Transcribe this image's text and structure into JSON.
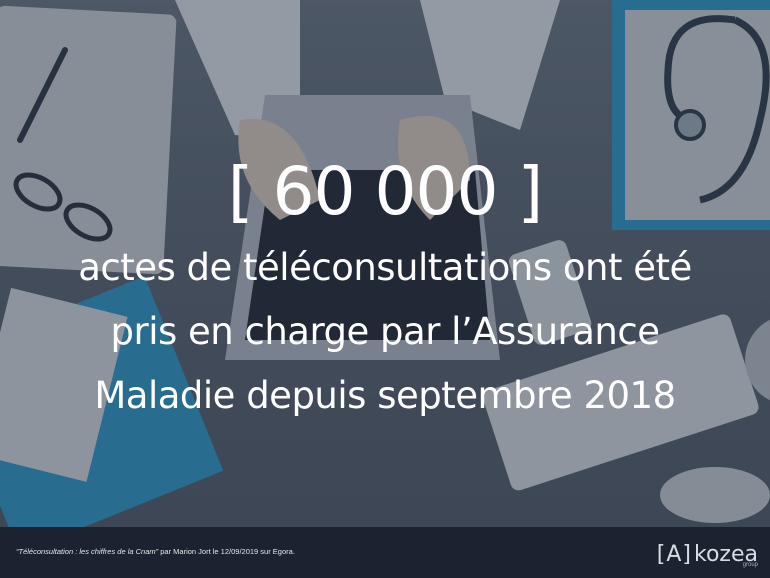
{
  "headline": {
    "number": "[ 60 000 ]",
    "lines": [
      "actes de téléconsultations ont été",
      "pris en charge par l’Assurance",
      "Maladie depuis septembre 2018"
    ]
  },
  "footer": {
    "source_title": "“Téléconsultation : les chiffres de la Cnam”",
    "source_rest": " par Marion Jort le 12/09/2019 sur Egora."
  },
  "logo": {
    "mark": "[A]",
    "word": "kozea",
    "sub": "group"
  },
  "colors": {
    "footer_bg": "#1b2230",
    "text": "#ffffff",
    "accent_blue": "#2a9fcf"
  }
}
